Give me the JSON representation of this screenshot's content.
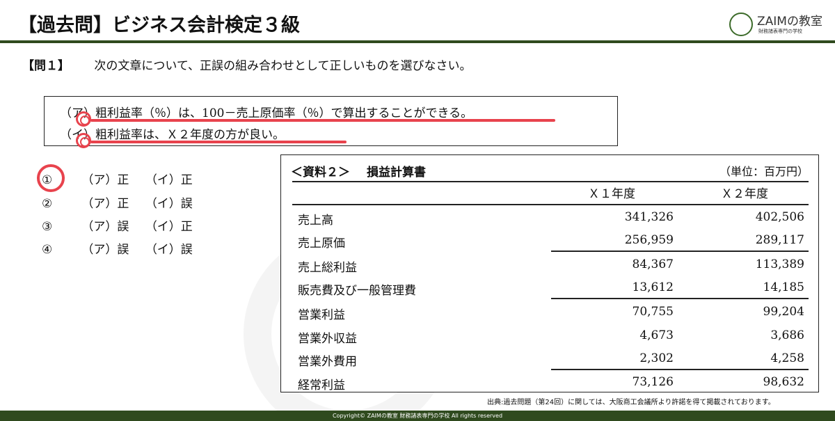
{
  "header": {
    "title": "【過去問】ビジネス会計検定３級",
    "logo_main": "ZAIMの教室",
    "logo_sub": "財務諸表専門の学校",
    "accent_color": "#2f4a1e"
  },
  "question": {
    "number": "【問１】",
    "text": "次の文章について、正誤の組み合わせとして正しいものを選びなさい。"
  },
  "statements": [
    "（ア）粗利益率（％）は、100－売上原価率（％）で算出することができる。",
    "（イ）粗利益率は、Ｘ２年度の方が良い。"
  ],
  "choices": [
    {
      "num": "①",
      "a": "（ア）正",
      "b": "（イ）正"
    },
    {
      "num": "②",
      "a": "（ア）正",
      "b": "（イ）誤"
    },
    {
      "num": "③",
      "a": "（ア）誤",
      "b": "（イ）正"
    },
    {
      "num": "④",
      "a": "（ア）誤",
      "b": "（イ）誤"
    }
  ],
  "selected_choice": "①",
  "highlight_color": "#e8434d",
  "table": {
    "title": "＜資料２＞",
    "doc_name": "損益計算書",
    "unit": "（単位：百万円）",
    "columns": [
      "Ｘ１年度",
      "Ｘ２年度"
    ],
    "rows": [
      {
        "label": "売上高",
        "x1": "341,326",
        "x2": "402,506"
      },
      {
        "label": "売上原価",
        "x1": "256,959",
        "x2": "289,117"
      },
      {
        "label": "売上総利益",
        "x1": "84,367",
        "x2": "113,389"
      },
      {
        "label": "販売費及び一般管理費",
        "x1": "13,612",
        "x2": "14,185"
      },
      {
        "label": "営業利益",
        "x1": "70,755",
        "x2": "99,204"
      },
      {
        "label": "営業外収益",
        "x1": "4,673",
        "x2": "3,686"
      },
      {
        "label": "営業外費用",
        "x1": "2,302",
        "x2": "4,258"
      },
      {
        "label": "経常利益",
        "x1": "73,126",
        "x2": "98,632"
      }
    ]
  },
  "source": "出典:過去問題（第24回）に関しては、大阪商工会議所より許諾を得て掲載されております。",
  "footer": "Copyright©  ZAIMの教室 財務諸表専門の学校 All rights reserved"
}
